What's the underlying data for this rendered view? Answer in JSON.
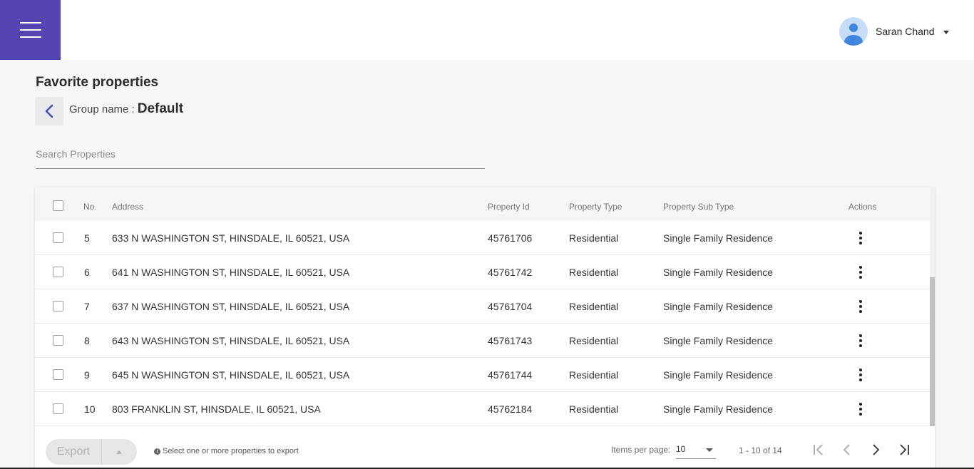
{
  "user": {
    "name": "Saran Chand"
  },
  "page": {
    "title": "Favorite properties",
    "group_label": "Group name :",
    "group_value": "Default"
  },
  "search": {
    "placeholder": "Search Properties",
    "value": ""
  },
  "table": {
    "columns": {
      "no": "No.",
      "address": "Address",
      "property_id": "Property Id",
      "property_type": "Property Type",
      "property_sub_type": "Property Sub Type",
      "actions": "Actions"
    },
    "rows": [
      {
        "no": "5",
        "address": "633 N WASHINGTON ST, HINSDALE, IL 60521, USA",
        "property_id": "45761706",
        "property_type": "Residential",
        "property_sub_type": "Single Family Residence"
      },
      {
        "no": "6",
        "address": "641 N WASHINGTON ST, HINSDALE, IL 60521, USA",
        "property_id": "45761742",
        "property_type": "Residential",
        "property_sub_type": "Single Family Residence"
      },
      {
        "no": "7",
        "address": "637 N WASHINGTON ST, HINSDALE, IL 60521, USA",
        "property_id": "45761704",
        "property_type": "Residential",
        "property_sub_type": "Single Family Residence"
      },
      {
        "no": "8",
        "address": "643 N WASHINGTON ST, HINSDALE, IL 60521, USA",
        "property_id": "45761743",
        "property_type": "Residential",
        "property_sub_type": "Single Family Residence"
      },
      {
        "no": "9",
        "address": "645 N WASHINGTON ST, HINSDALE, IL 60521, USA",
        "property_id": "45761744",
        "property_type": "Residential",
        "property_sub_type": "Single Family Residence"
      },
      {
        "no": "10",
        "address": "803 FRANKLIN ST, HINSDALE, IL 60521, USA",
        "property_id": "45762184",
        "property_type": "Residential",
        "property_sub_type": "Single Family Residence"
      }
    ]
  },
  "footer": {
    "export_label": "Export",
    "hint": "Select one or more properties to export",
    "items_per_page_label": "Items per page:",
    "items_per_page_value": "10",
    "range": "1 - 10 of 14"
  },
  "colors": {
    "accent": "#5346b3",
    "back_icon": "#3f51b5"
  },
  "icons": {
    "menu": "hamburger-icon",
    "back": "chevron-left-icon",
    "row_actions": "more-vert-icon",
    "first_page": "first-page-icon",
    "prev_page": "chevron-left-icon",
    "next_page": "chevron-right-icon",
    "last_page": "last-page-icon",
    "info": "info-icon"
  }
}
